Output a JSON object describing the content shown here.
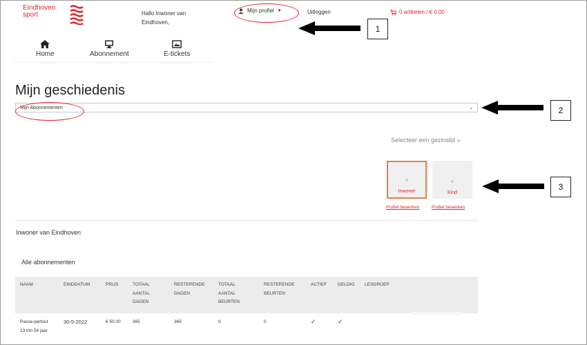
{
  "brand": {
    "logo_text_line1": "Eindhoven",
    "logo_text_line2": "sport",
    "color": "#e2222c"
  },
  "header": {
    "greeting_line1": "Hallo Inwoner van",
    "greeting_line2": "Eindhoven,",
    "profile_label": "Mijn profiel",
    "logout_label": "Uitloggen",
    "cart_label": "0 artikelen / € 0,00"
  },
  "nav": [
    {
      "label": "Home",
      "icon": "home-icon"
    },
    {
      "label": "Abonnement",
      "icon": "monitor-icon"
    },
    {
      "label": "E-tickets",
      "icon": "ticket-icon"
    }
  ],
  "page": {
    "title": "Mijn geschiedenis",
    "select_value": "Mijn Abonnementen",
    "member_link": "Selecteer een gezinslid »"
  },
  "members": [
    {
      "name": "Inwoner",
      "edit_label": "Profiel bewerken",
      "selected": true
    },
    {
      "name": "Kind",
      "edit_label": "Profiel bewerken",
      "selected": false
    }
  ],
  "owner_name": "Inwoner van Eindhoven",
  "section_title": "Alle abonnementen",
  "table": {
    "headers": [
      [
        "NAAM"
      ],
      [
        "EINDDATUM"
      ],
      [
        "PRIJS"
      ],
      [
        "TOTAAL",
        "AANTAL",
        "DAGEN"
      ],
      [
        "RESTERENDE",
        "DAGEN"
      ],
      [
        "TOTAAL",
        "AANTAL",
        "BEURTEN"
      ],
      [
        "RESTERENDE",
        "BEURTEN"
      ],
      [
        "ACTIEF"
      ],
      [
        "GELDIG"
      ],
      [
        "LESGROEP"
      ]
    ],
    "rows": [
      {
        "name_line1": "Passe-partout",
        "name_line2": "13 t/m 54 jaar",
        "enddate": "30-5-2022",
        "price": "€ 50,00",
        "total_days": "365",
        "remaining_days": "365",
        "total_visits": "0",
        "remaining_visits": "0",
        "active": "✓",
        "valid": "✓",
        "lesson_group": ""
      }
    ]
  },
  "annotations": [
    "1",
    "2",
    "3"
  ]
}
